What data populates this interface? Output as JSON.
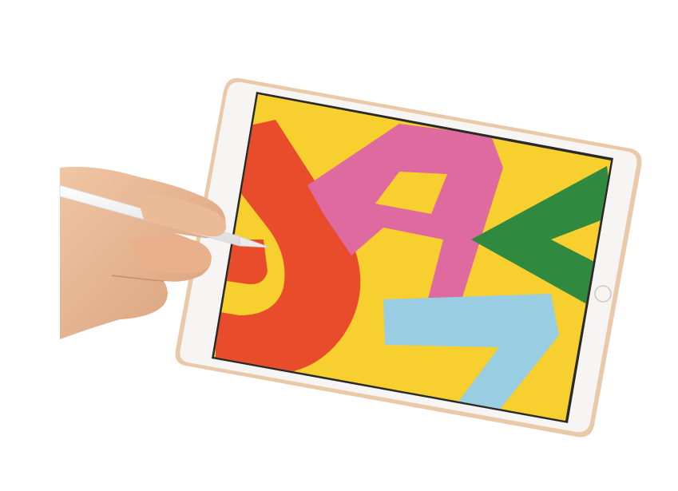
{
  "colors": {
    "background": "#ffffff",
    "tablet_rim": "#e9c9a8",
    "tablet_bezel": "#f6f5f3",
    "screen_yellow": "#f7cf2f",
    "shape_red": "#e84c2a",
    "shape_pink": "#de6a9f",
    "shape_green": "#2f8a40",
    "shape_blue": "#98cde2",
    "pencil": "#f2f2f2",
    "skin": "#e9b793"
  },
  "icons": {
    "home_button": "home-button-icon",
    "stylus": "stylus-icon"
  }
}
